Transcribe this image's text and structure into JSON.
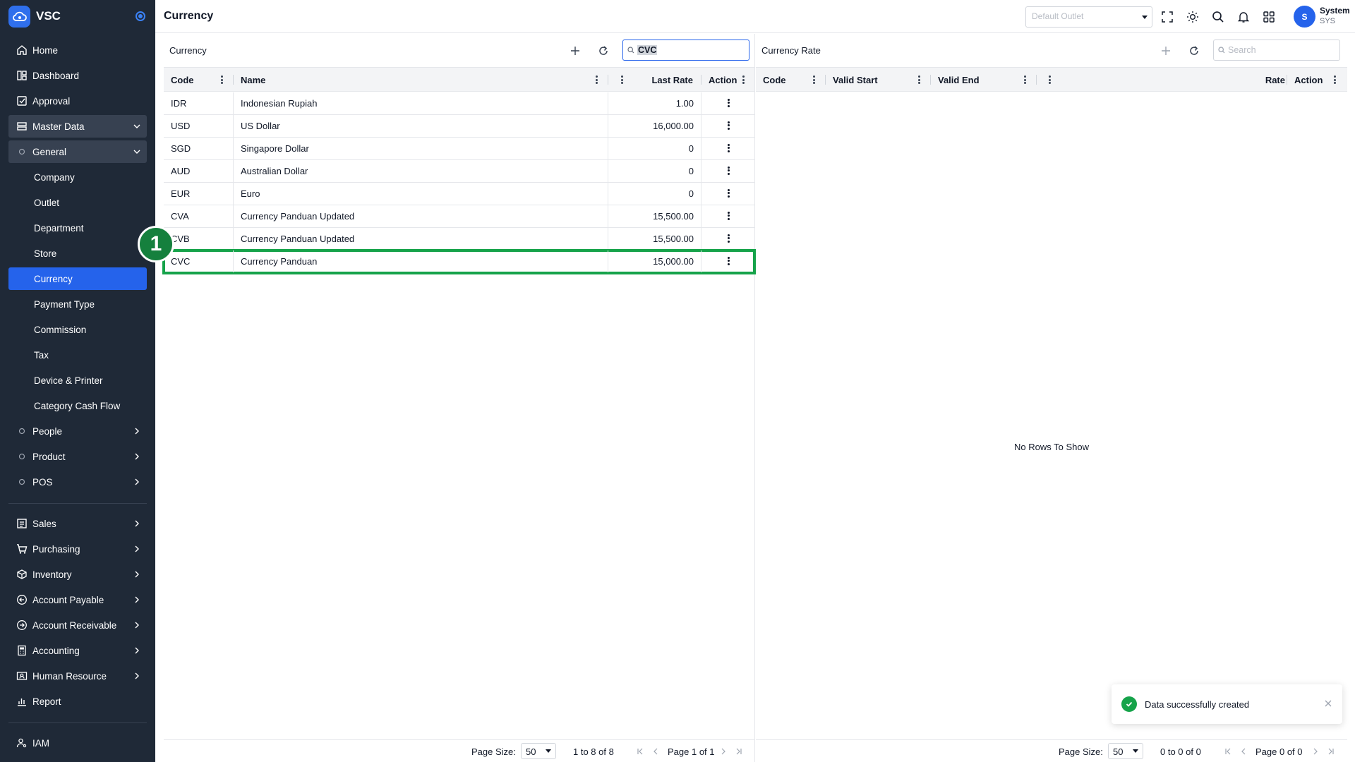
{
  "app": {
    "brand": "VSC"
  },
  "sidebar": {
    "items": [
      {
        "label": "Home"
      },
      {
        "label": "Dashboard"
      },
      {
        "label": "Approval"
      },
      {
        "label": "Master Data"
      },
      {
        "label": "General"
      },
      {
        "label": "Company"
      },
      {
        "label": "Outlet"
      },
      {
        "label": "Department"
      },
      {
        "label": "Store"
      },
      {
        "label": "Currency"
      },
      {
        "label": "Payment Type"
      },
      {
        "label": "Commission"
      },
      {
        "label": "Tax"
      },
      {
        "label": "Device & Printer"
      },
      {
        "label": "Category Cash Flow"
      },
      {
        "label": "People"
      },
      {
        "label": "Product"
      },
      {
        "label": "POS"
      },
      {
        "label": "Sales"
      },
      {
        "label": "Purchasing"
      },
      {
        "label": "Inventory"
      },
      {
        "label": "Account Payable"
      },
      {
        "label": "Account Receivable"
      },
      {
        "label": "Accounting"
      },
      {
        "label": "Human Resource"
      },
      {
        "label": "Report"
      },
      {
        "label": "IAM"
      }
    ]
  },
  "header": {
    "title": "Currency",
    "outlet_placeholder": "Default Outlet",
    "user_initial": "S",
    "user_name": "System",
    "user_code": "SYS"
  },
  "currency_panel": {
    "title": "Currency",
    "search_value": "CVC",
    "columns": {
      "code": "Code",
      "name": "Name",
      "last_rate": "Last Rate",
      "action": "Action"
    },
    "rows": [
      {
        "code": "IDR",
        "name": "Indonesian Rupiah",
        "last_rate": "1.00"
      },
      {
        "code": "USD",
        "name": "US Dollar",
        "last_rate": "16,000.00"
      },
      {
        "code": "SGD",
        "name": "Singapore Dollar",
        "last_rate": "0"
      },
      {
        "code": "AUD",
        "name": "Australian Dollar",
        "last_rate": "0"
      },
      {
        "code": "EUR",
        "name": "Euro",
        "last_rate": "0"
      },
      {
        "code": "CVA",
        "name": "Currency Panduan Updated",
        "last_rate": "15,500.00"
      },
      {
        "code": "CVB",
        "name": "Currency Panduan Updated",
        "last_rate": "15,500.00"
      },
      {
        "code": "CVC",
        "name": "Currency Panduan",
        "last_rate": "15,000.00"
      }
    ],
    "footer": {
      "page_size_label": "Page Size:",
      "page_size": "50",
      "range": "1 to 8 of 8",
      "page": "Page 1 of 1"
    }
  },
  "rate_panel": {
    "title": "Currency Rate",
    "search_placeholder": "Search",
    "columns": {
      "code": "Code",
      "valid_start": "Valid Start",
      "valid_end": "Valid End",
      "rate": "Rate",
      "action": "Action"
    },
    "empty_message": "No Rows To Show",
    "footer": {
      "page_size_label": "Page Size:",
      "page_size": "50",
      "range": "0 to 0 of 0",
      "page": "Page 0 of 0"
    }
  },
  "step_badge": "1",
  "toast": {
    "message": "Data successfully created"
  },
  "colors": {
    "sidebar_bg": "#1f2937",
    "accent": "#2563eb",
    "highlight": "#16a34a",
    "success": "#16a34a"
  }
}
